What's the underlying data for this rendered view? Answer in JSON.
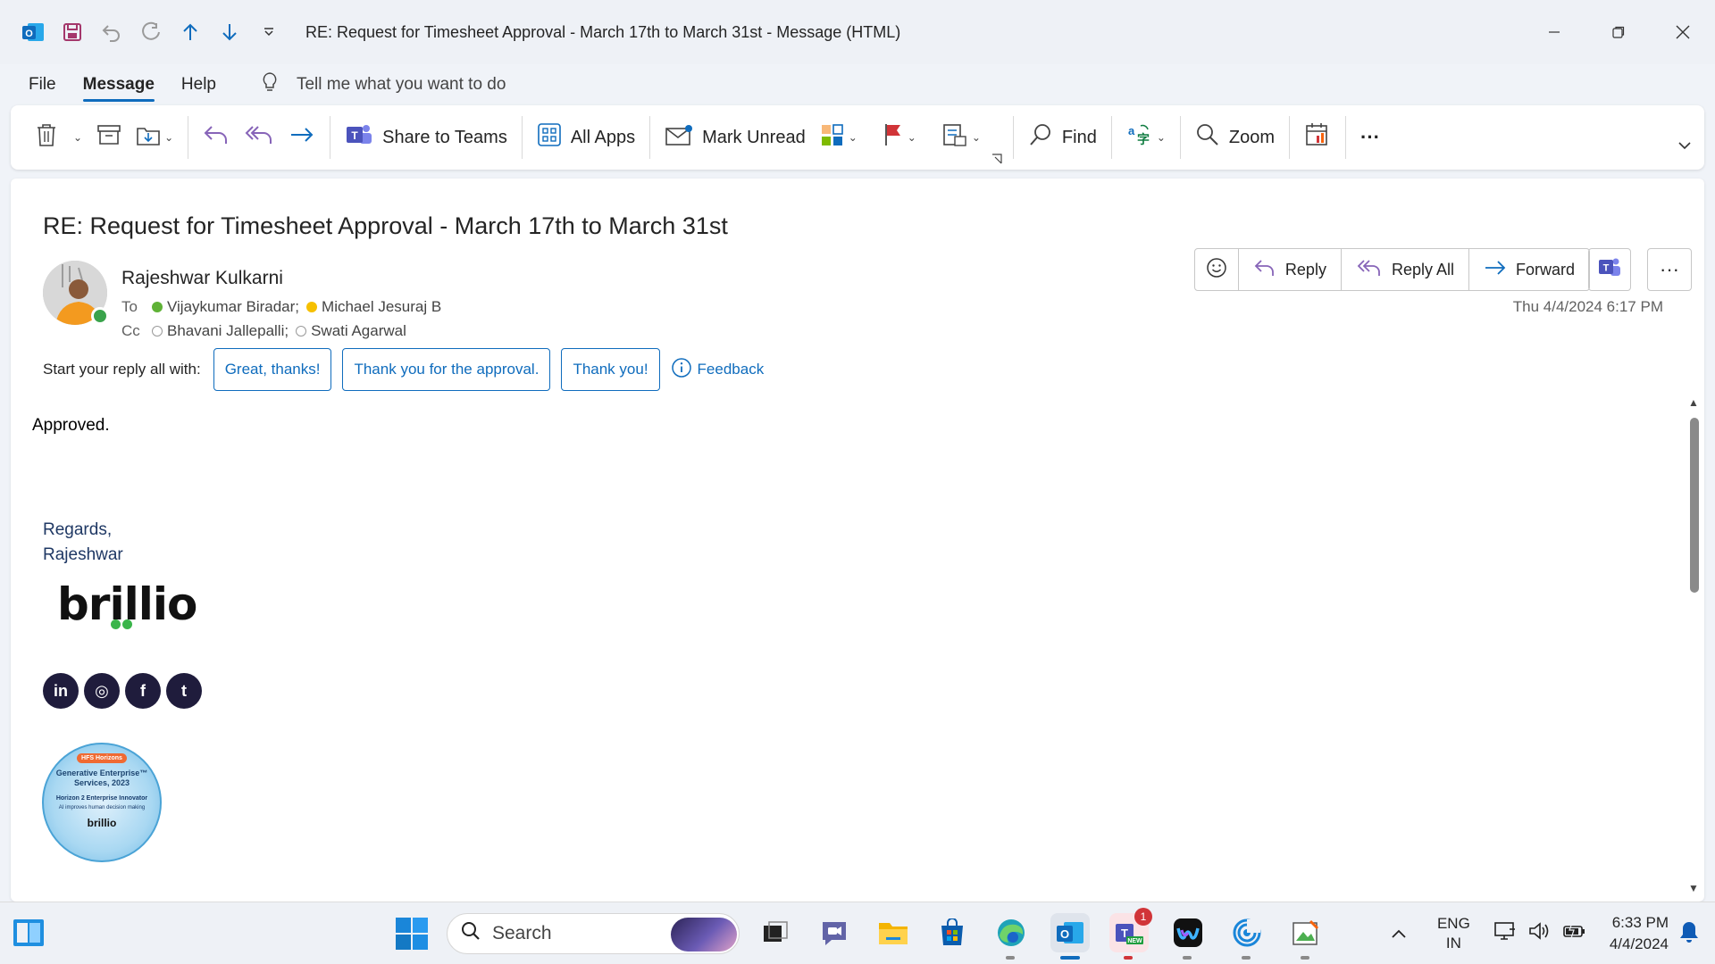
{
  "titlebar": {
    "title": "RE: Request for Timesheet Approval - March 17th to March 31st  -  Message (HTML)",
    "quick_access": [
      "outlook-app-icon",
      "save-icon",
      "undo-icon",
      "redo-icon",
      "previous-item-icon",
      "next-item-icon",
      "customize-quick-access-icon"
    ]
  },
  "menu": {
    "tabs": [
      "File",
      "Message",
      "Help"
    ],
    "active_tab": "Message",
    "tell_me": "Tell me what you want to do"
  },
  "ribbon": {
    "share_to_teams": "Share to Teams",
    "all_apps": "All Apps",
    "mark_unread": "Mark Unread",
    "find": "Find",
    "zoom": "Zoom",
    "more": "···"
  },
  "message": {
    "subject": "RE: Request for Timesheet Approval - March 17th to March 31st",
    "sender": "Rajeshwar Kulkarni",
    "to_label": "To",
    "cc_label": "Cc",
    "to": [
      {
        "name": "Vijaykumar Biradar;",
        "presence": "available"
      },
      {
        "name": "Michael Jesuraj B",
        "presence": "away"
      }
    ],
    "cc": [
      {
        "name": "Bhavani Jallepalli;",
        "presence": "offline"
      },
      {
        "name": "Swati Agarwal",
        "presence": "offline"
      }
    ],
    "datetime": "Thu 4/4/2024 6:17 PM",
    "actions": {
      "reply": "Reply",
      "reply_all": "Reply All",
      "forward": "Forward",
      "more": "···"
    },
    "suggest_prompt": "Start your reply all with:",
    "suggestions": [
      "Great, thanks!",
      "Thank you for the approval.",
      "Thank you!"
    ],
    "feedback": "Feedback",
    "body": "Approved.",
    "signature": {
      "regards": "Regards,",
      "name": "Rajeshwar",
      "logo": "brillio",
      "socials": [
        "in",
        "◎",
        "f",
        "t"
      ],
      "badge": {
        "tag": "HFS Horizons",
        "title": "Generative Enterprise™ Services, 2023",
        "subtitle": "Horizon 2 Enterprise Innovator",
        "line": "AI improves human decision making",
        "brand": "brillio"
      }
    }
  },
  "taskbar": {
    "search": "Search",
    "notification_count": "1",
    "lang_top": "ENG",
    "lang_bottom": "IN",
    "time": "6:33 PM",
    "date": "4/4/2024"
  },
  "colors": {
    "accent": "#0f6cbd",
    "teams": "#5b5fc7",
    "reply_purple": "#8764b8",
    "flag_red": "#d13438",
    "presence_green": "#5fb236",
    "presence_yellow": "#f6c000"
  }
}
